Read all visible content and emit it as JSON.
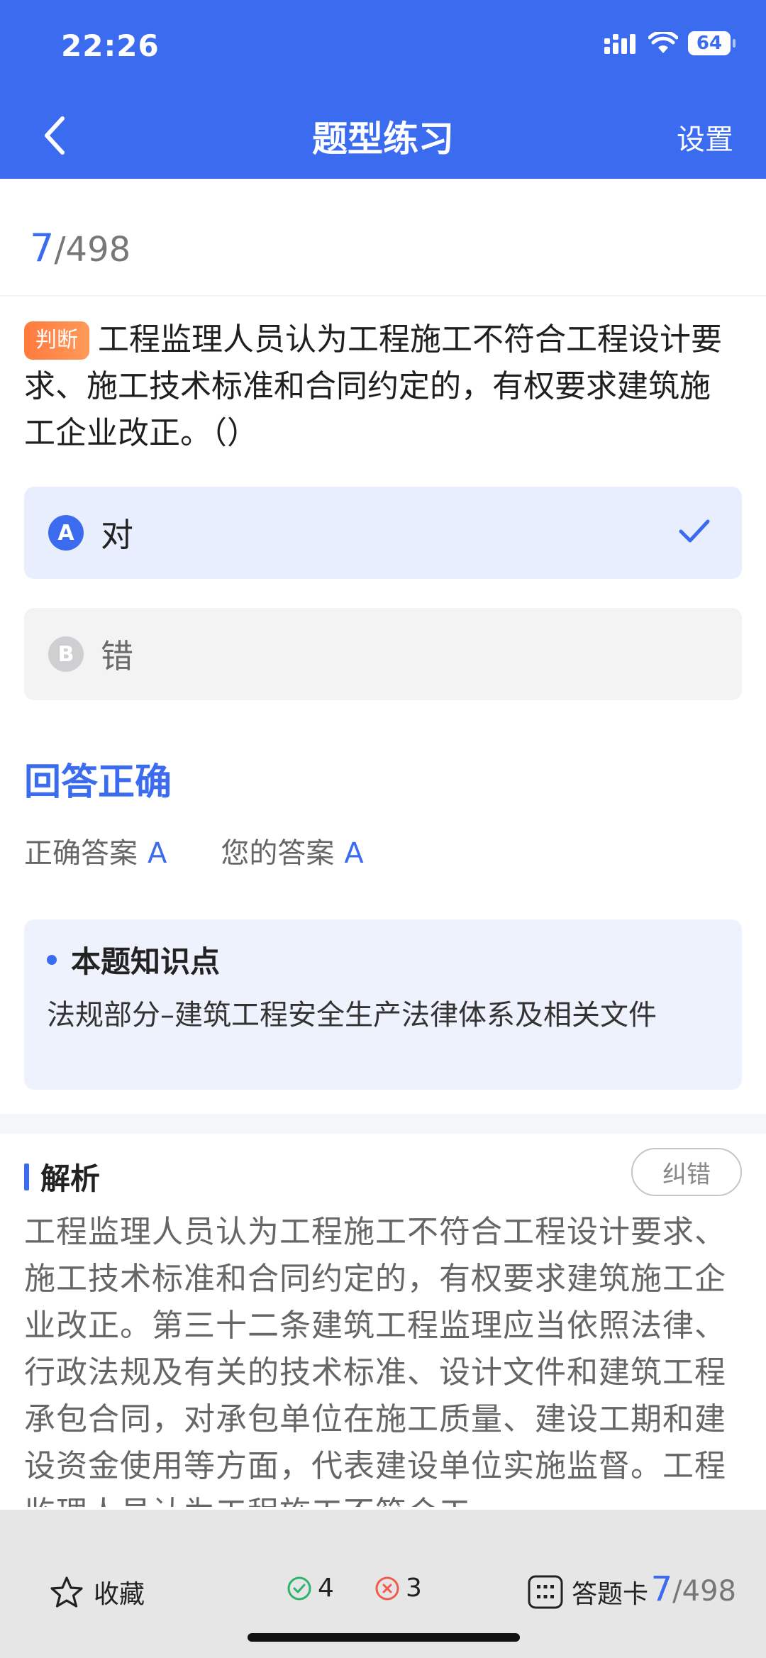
{
  "status": {
    "time": "22:26",
    "battery": "64"
  },
  "nav": {
    "title": "题型练习",
    "settings": "设置"
  },
  "progress": {
    "current": "7",
    "total": "/498"
  },
  "question": {
    "tag": "判断",
    "text": "工程监理人员认为工程施工不符合工程设计要求、施工技术标准和合同约定的，有权要求建筑施工企业改正。（）"
  },
  "options": [
    {
      "letter": "A",
      "text": "对",
      "selected": true
    },
    {
      "letter": "B",
      "text": "错",
      "selected": false
    }
  ],
  "result": {
    "title": "回答正确",
    "correct_label": "正确答案",
    "correct_value": "A",
    "yours_label": "您的答案",
    "yours_value": "A"
  },
  "knowledge": {
    "title": "本题知识点",
    "text": "法规部分–建筑工程安全生产法律体系及相关文件"
  },
  "analysis": {
    "title": "解析",
    "report_label": "纠错",
    "text": "工程监理人员认为工程施工不符合工程设计要求、施工技术标准和合同约定的，有权要求建筑施工企业改正。第三十二条建筑工程监理应当依照法律、行政法规及有关的技术标准、设计文件和建筑工程承包合同，对承包单位在施工质量、建设工期和建设资金使用等方面，代表建设单位实施监督。工程监理人员认为工程施工不符合工"
  },
  "bottom": {
    "favorite_label": "收藏",
    "correct_count": "4",
    "wrong_count": "3",
    "card_label": "答题卡",
    "current": "7",
    "total": "/498"
  },
  "colors": {
    "primary": "#3B6CF0",
    "tag": "#FF7A3D",
    "correct": "#2DB36A",
    "wrong": "#F15B4B"
  }
}
